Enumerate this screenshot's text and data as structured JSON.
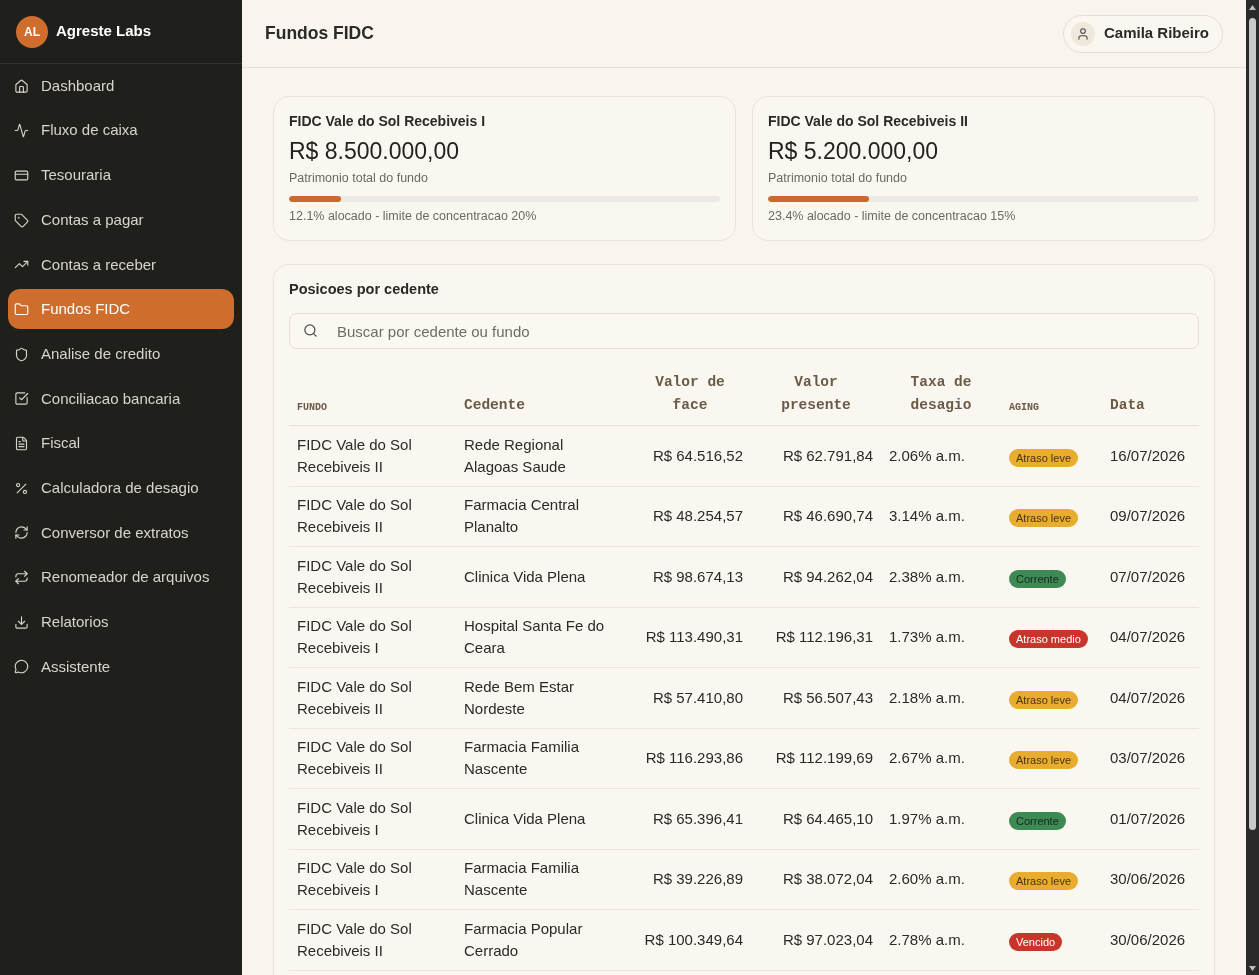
{
  "sidebar": {
    "brand": {
      "initials": "AL",
      "name": "Agreste Labs"
    },
    "items": [
      {
        "label": "Dashboard",
        "selected": false
      },
      {
        "label": "Fluxo de caixa",
        "selected": false
      },
      {
        "label": "Tesouraria",
        "selected": false
      },
      {
        "label": "Contas a pagar",
        "selected": false
      },
      {
        "label": "Contas a receber",
        "selected": false
      },
      {
        "label": "Fundos FIDC",
        "selected": true
      },
      {
        "label": "Analise de credito",
        "selected": false
      },
      {
        "label": "Conciliacao bancaria",
        "selected": false
      },
      {
        "label": "Fiscal",
        "selected": false
      },
      {
        "label": "Calculadora de desagio",
        "selected": false
      },
      {
        "label": "Conversor de extratos",
        "selected": false
      },
      {
        "label": "Renomeador de arquivos",
        "selected": false
      },
      {
        "label": "Relatorios",
        "selected": false
      },
      {
        "label": "Assistente",
        "selected": false
      }
    ]
  },
  "header": {
    "title": "Fundos FIDC",
    "user": "Camila Ribeiro"
  },
  "funds": [
    {
      "name": "FIDC Vale do Sol Recebiveis I",
      "amount": "R$ 8.500.000,00",
      "caption": "Patrimonio total do fundo",
      "level": 0.121,
      "allocation": "12.1% alocado - limite de concentracao 20%"
    },
    {
      "name": "FIDC Vale do Sol Recebiveis II",
      "amount": "R$ 5.200.000,00",
      "caption": "Patrimonio total do fundo",
      "level": 0.234,
      "allocation": "23.4% alocado - limite de concentracao 15%"
    }
  ],
  "positions": {
    "title": "Posicoes por cedente",
    "search": {
      "placeholder": "Buscar por cedente ou fundo"
    },
    "columns": [
      {
        "label": "FUNDO",
        "kind": "caps"
      },
      {
        "label": "Cedente",
        "kind": "title"
      },
      {
        "label": "Valor de face",
        "kind": "title"
      },
      {
        "label": "Valor presente",
        "kind": "title"
      },
      {
        "label": "Taxa de desagio",
        "kind": "title"
      },
      {
        "label": "AGING",
        "kind": "caps"
      },
      {
        "label": "Data",
        "kind": "title"
      }
    ],
    "rows": [
      {
        "fundo": "FIDC Vale do Sol Recebiveis II",
        "cedente": "Rede Regional Alagoas Saude",
        "valor_face": "R$ 64.516,52",
        "valor_presente": "R$ 62.791,84",
        "taxa": "2.06% a.m.",
        "aging": {
          "label": "Atraso leve",
          "color": "#e8ad2f"
        },
        "data": "16/07/2026"
      },
      {
        "fundo": "FIDC Vale do Sol Recebiveis II",
        "cedente": "Farmacia Central Planalto",
        "valor_face": "R$ 48.254,57",
        "valor_presente": "R$ 46.690,74",
        "taxa": "3.14% a.m.",
        "aging": {
          "label": "Atraso leve",
          "color": "#e8ad2f"
        },
        "data": "09/07/2026"
      },
      {
        "fundo": "FIDC Vale do Sol Recebiveis II",
        "cedente": "Clinica Vida Plena",
        "valor_face": "R$ 98.674,13",
        "valor_presente": "R$ 94.262,04",
        "taxa": "2.38% a.m.",
        "aging": {
          "label": "Corrente",
          "color": "#3e8a55"
        },
        "data": "07/07/2026"
      },
      {
        "fundo": "FIDC Vale do Sol Recebiveis I",
        "cedente": "Hospital Santa Fe do Ceara",
        "valor_face": "R$ 113.490,31",
        "valor_presente": "R$ 112.196,31",
        "taxa": "1.73% a.m.",
        "aging": {
          "label": "Atraso medio",
          "color": "#c8352b"
        },
        "data": "04/07/2026"
      },
      {
        "fundo": "FIDC Vale do Sol Recebiveis II",
        "cedente": "Rede Bem Estar Nordeste",
        "valor_face": "R$ 57.410,80",
        "valor_presente": "R$ 56.507,43",
        "taxa": "2.18% a.m.",
        "aging": {
          "label": "Atraso leve",
          "color": "#e8ad2f"
        },
        "data": "04/07/2026"
      },
      {
        "fundo": "FIDC Vale do Sol Recebiveis II",
        "cedente": "Farmacia Familia Nascente",
        "valor_face": "R$ 116.293,86",
        "valor_presente": "R$ 112.199,69",
        "taxa": "2.67% a.m.",
        "aging": {
          "label": "Atraso leve",
          "color": "#e8ad2f"
        },
        "data": "03/07/2026"
      },
      {
        "fundo": "FIDC Vale do Sol Recebiveis I",
        "cedente": "Clinica Vida Plena",
        "valor_face": "R$ 65.396,41",
        "valor_presente": "R$ 64.465,10",
        "taxa": "1.97% a.m.",
        "aging": {
          "label": "Corrente",
          "color": "#3e8a55"
        },
        "data": "01/07/2026"
      },
      {
        "fundo": "FIDC Vale do Sol Recebiveis I",
        "cedente": "Farmacia Familia Nascente",
        "valor_face": "R$ 39.226,89",
        "valor_presente": "R$ 38.072,04",
        "taxa": "2.60% a.m.",
        "aging": {
          "label": "Atraso leve",
          "color": "#e8ad2f"
        },
        "data": "30/06/2026"
      },
      {
        "fundo": "FIDC Vale do Sol Recebiveis II",
        "cedente": "Farmacia Popular Cerrado",
        "valor_face": "R$ 100.349,64",
        "valor_presente": "R$ 97.023,04",
        "taxa": "2.78% a.m.",
        "aging": {
          "label": "Vencido",
          "color": "#c8352b"
        },
        "data": "30/06/2026"
      }
    ]
  }
}
